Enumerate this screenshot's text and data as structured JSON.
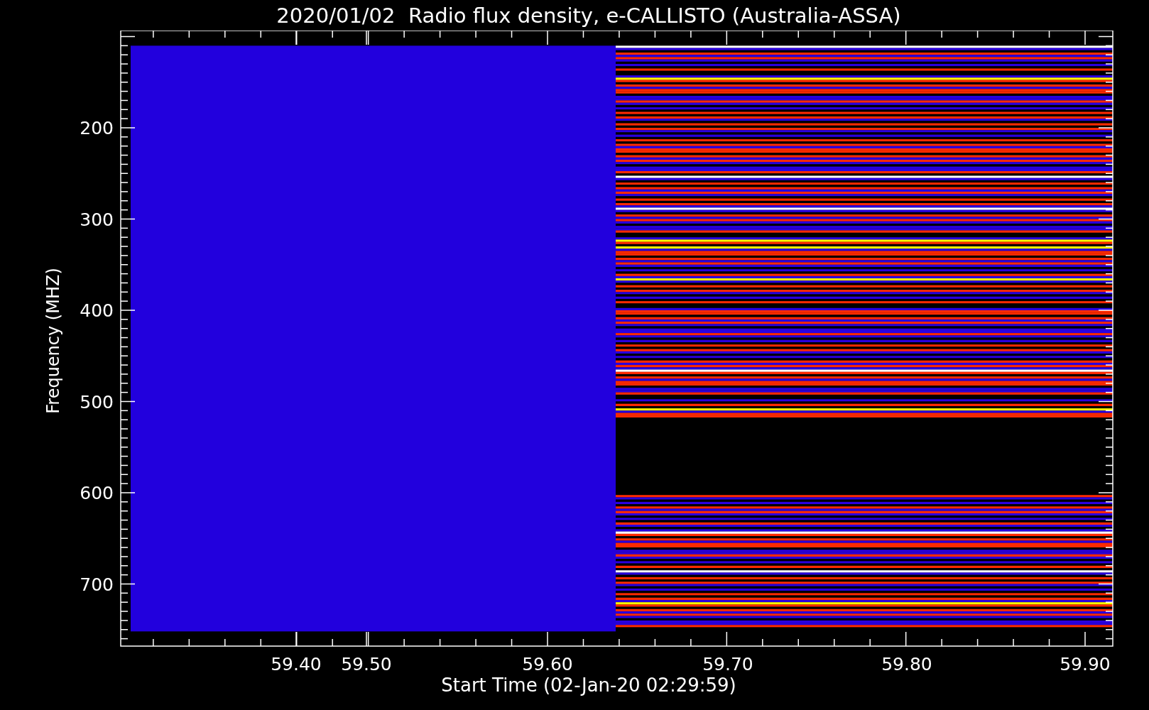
{
  "plot": {
    "title": "2020/01/02  Radio flux density, e-CALLISTO (Australia-ASSA)",
    "xlabel": "Start Time (02-Jan-20 02:29:59)",
    "ylabel": "Frequency (MHZ)",
    "x_tick_labels": [
      "59.40",
      "59.50",
      "59.60",
      "59.70",
      "59.80",
      "59.90"
    ],
    "y_tick_labels": [
      "200",
      "300",
      "400",
      "500",
      "600",
      "700"
    ]
  }
}
